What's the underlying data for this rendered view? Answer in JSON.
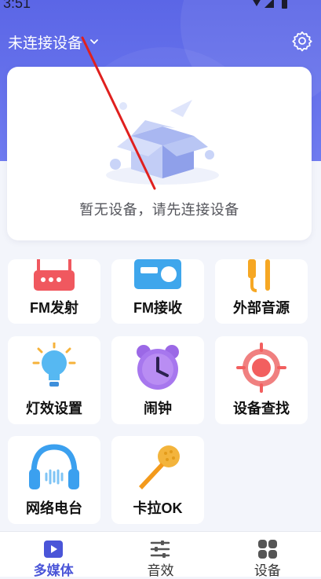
{
  "status_bar": {
    "time": "3:51"
  },
  "header": {
    "device_label": "未连接设备"
  },
  "empty_state": {
    "message": "暂无设备，请先连接设备"
  },
  "features": [
    {
      "label": "FM发射",
      "icon": "fm-transmitter-icon"
    },
    {
      "label": "FM接收",
      "icon": "fm-radio-icon"
    },
    {
      "label": "外部音源",
      "icon": "aux-cable-icon"
    },
    {
      "label": "灯效设置",
      "icon": "light-bulb-icon"
    },
    {
      "label": "闹钟",
      "icon": "alarm-clock-icon"
    },
    {
      "label": "设备查找",
      "icon": "locate-target-icon"
    },
    {
      "label": "网络电台",
      "icon": "headphones-icon"
    },
    {
      "label": "卡拉OK",
      "icon": "microphone-icon"
    }
  ],
  "bottom_nav": [
    {
      "label": "多媒体",
      "icon": "play-icon",
      "active": true
    },
    {
      "label": "音效",
      "icon": "equalizer-icon",
      "active": false
    },
    {
      "label": "设备",
      "icon": "grid-icon",
      "active": false
    }
  ],
  "colors": {
    "brand": "#5b66e6",
    "active_nav": "#4a55d8",
    "annotation": "#e0201e"
  }
}
